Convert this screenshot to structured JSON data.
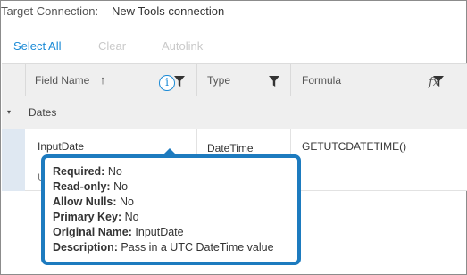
{
  "target": {
    "label": "Target Connection:",
    "value": "New Tools connection"
  },
  "actions": {
    "select_all": "Select All",
    "clear": "Clear",
    "autolink": "Autolink"
  },
  "columns": {
    "field_name": "Field Name",
    "sort_indicator": "↑",
    "type": "Type",
    "formula": "Formula"
  },
  "group": {
    "caret": "▾",
    "name": "Dates"
  },
  "row": {
    "field": "InputDate",
    "type": "DateTime",
    "formula": "GETUTCDATETIME()",
    "fx": "fx"
  },
  "row2": {
    "partial_text": "U"
  },
  "tooltip": {
    "lines": [
      {
        "key": "Required:",
        "value": " No"
      },
      {
        "key": "Read-only:",
        "value": " No"
      },
      {
        "key": "Allow Nulls:",
        "value": " No"
      },
      {
        "key": "Primary Key:",
        "value": " No"
      },
      {
        "key": "Original Name:",
        "value": " InputDate"
      },
      {
        "key": "Description:",
        "value": " Pass in a UTC DateTime value"
      }
    ]
  },
  "colors": {
    "accent": "#1a8ad6",
    "tooltip_border": "#1d7bbf",
    "disabled": "#c9c9c9",
    "header_bg": "#efefef"
  },
  "icons": {
    "info": "info-icon",
    "filter": "filter-icon",
    "formula": "fx-icon",
    "sort": "sort-ascending-icon",
    "caret": "caret-down-icon"
  }
}
